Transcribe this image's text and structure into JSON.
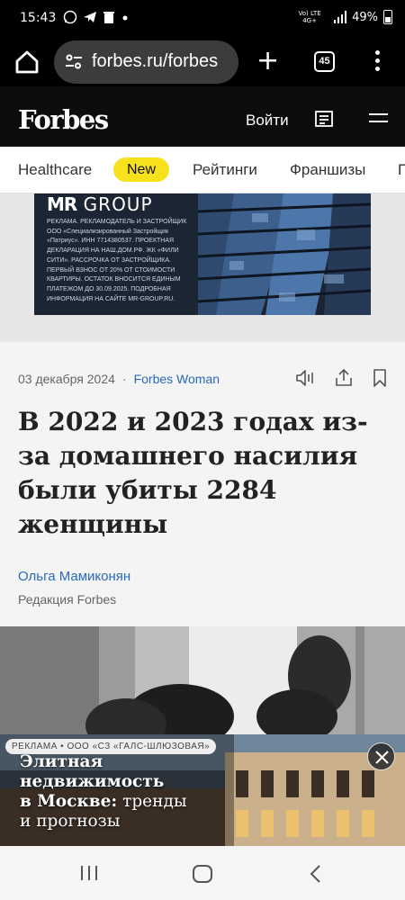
{
  "status_bar": {
    "time": "15:43",
    "network": "Vo) LTE 4G+",
    "battery": "49%"
  },
  "browser": {
    "url": "forbes.ru/forbes",
    "tab_count": "45"
  },
  "site": {
    "logo": "Forbes",
    "login_label": "Войти"
  },
  "categories": {
    "healthcare": "Healthcare",
    "new_badge": "New",
    "ratings": "Рейтинги",
    "franchises": "Франшизы",
    "next": "П"
  },
  "top_ad": {
    "brand_mr": "MR",
    "brand_group": "GROUP",
    "fine_print": "РЕКЛАМА. РЕКЛАМОДАТЕЛЬ И ЗАСТРОЙЩИК ООО «Специализированный Застройщик «Патриус». ИНН 7714380537. ПРОЕКТНАЯ ДЕКЛАРАЦИЯ НА НАШ.ДОМ.РФ. ЖК «ФИЛИ СИТИ». РАССРОЧКА ОТ ЗАСТРОЙЩИКА. ПЕРВЫЙ ВЗНОС ОТ 20% ОТ СТОИМОСТИ КВАРТИРЫ. ОСТАТОК ВНОСИТСЯ ЕДИНЫМ ПЛАТЕЖОМ ДО 30.09.2025. ПОДРОБНАЯ ИНФОРМАЦИЯ НА САЙТЕ MR-GROUP.RU."
  },
  "article": {
    "date": "03 декабря 2024",
    "separator": "·",
    "section": "Forbes Woman",
    "headline": "В 2022 и 2023 годах из-за домашнего насилия были убиты 2284 женщины",
    "author": "Ольга Мамиконян",
    "editorial": "Редакция Forbes"
  },
  "bottom_ad": {
    "label": "РЕКЛАМА • ООО «СЗ «ГАЛС-ШЛЮЗОВАЯ»",
    "title_bold_1": "Элитная",
    "title_bold_2": "недвижимость",
    "title_bold_3": "в Москве:",
    "title_rest_1": "тренды",
    "title_rest_2": "и прогнозы"
  },
  "colors": {
    "accent_yellow": "#f7e11d",
    "link_blue": "#2a69b8",
    "header_bg": "#0d0d0d"
  }
}
